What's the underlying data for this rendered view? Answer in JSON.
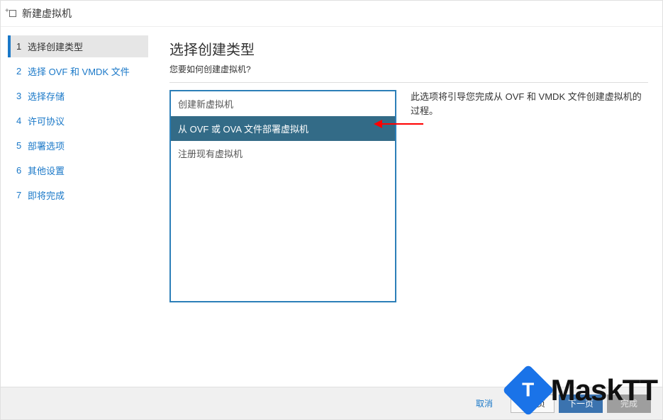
{
  "window": {
    "title": "新建虚拟机"
  },
  "sidebar": {
    "steps": [
      {
        "num": "1",
        "label": "选择创建类型",
        "active": true
      },
      {
        "num": "2",
        "label": "选择 OVF 和 VMDK 文件",
        "active": false
      },
      {
        "num": "3",
        "label": "选择存储",
        "active": false
      },
      {
        "num": "4",
        "label": "许可协议",
        "active": false
      },
      {
        "num": "5",
        "label": "部署选项",
        "active": false
      },
      {
        "num": "6",
        "label": "其他设置",
        "active": false
      },
      {
        "num": "7",
        "label": "即将完成",
        "active": false
      }
    ]
  },
  "content": {
    "title": "选择创建类型",
    "subtitle": "您要如何创建虚拟机?",
    "options": [
      {
        "label": "创建新虚拟机",
        "selected": false
      },
      {
        "label": "从 OVF 或 OVA 文件部署虚拟机",
        "selected": true
      },
      {
        "label": "注册现有虚拟机",
        "selected": false
      }
    ],
    "description": "此选项将引导您完成从 OVF 和 VMDK 文件创建虚拟机的过程。"
  },
  "footer": {
    "cancel": "取消",
    "back": "上一页",
    "next": "下一页",
    "finish": "完成"
  },
  "watermark": {
    "logo_letter": "T",
    "text": "MaskTT"
  }
}
